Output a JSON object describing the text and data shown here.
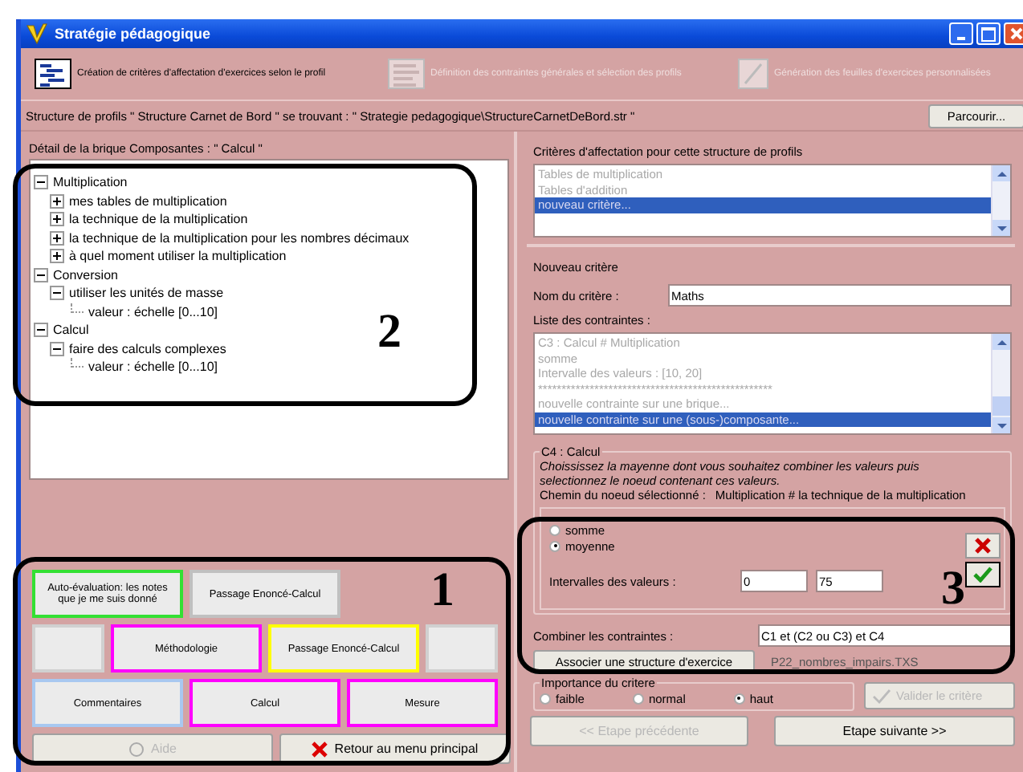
{
  "window": {
    "title": "Stratégie pédagogique"
  },
  "toolbar": [
    {
      "label": "Création de critères d'affectation d'exercices selon le profil",
      "disabled": false
    },
    {
      "label": "Définition des contraintes générales et sélection des profils",
      "disabled": true
    },
    {
      "label": "Génération des feuilles d'exercices personnalisées",
      "disabled": true
    }
  ],
  "structure_path": "Structure de profils \" Structure Carnet de Bord \" se trouvant : \" Strategie pedagogique\\StructureCarnetDeBord.str \"",
  "browse_button": "Parcourir...",
  "detail_title": "Détail de la brique Composantes : \" Calcul \"",
  "tree": [
    {
      "label": "Multiplication",
      "expanded": true,
      "children": [
        {
          "label": "mes tables de multiplication",
          "expanded": false
        },
        {
          "label": "la technique de la multiplication",
          "expanded": false
        },
        {
          "label": "la technique de la multiplication pour les nombres décimaux",
          "expanded": false
        },
        {
          "label": "à quel moment utiliser la multiplication",
          "expanded": false
        }
      ]
    },
    {
      "label": "Conversion",
      "expanded": true,
      "children": [
        {
          "label": "utiliser les unités de masse",
          "expanded": true,
          "children": [
            {
              "label": "valeur : échelle [0...10]"
            }
          ]
        }
      ]
    },
    {
      "label": "Calcul",
      "expanded": true,
      "children": [
        {
          "label": "faire des calculs complexes",
          "expanded": true,
          "children": [
            {
              "label": "valeur : échelle [0...10]"
            }
          ]
        }
      ]
    }
  ],
  "category_rows": [
    {
      "buttons": [
        {
          "kind": "wide",
          "label": "Auto-évaluation: les notes que je me suis donné",
          "color": "#33e033"
        },
        {
          "kind": "wide",
          "label": "Passage Enoncé-Calcul",
          "color": "#c0c0c0"
        }
      ]
    },
    {
      "buttons": [
        {
          "kind": "blank",
          "color": "#d0d0d0"
        },
        {
          "kind": "wide",
          "label": "Méthodologie",
          "color": "#ff00ff"
        },
        {
          "kind": "wide",
          "label": "Passage Enoncé-Calcul",
          "color": "#ffff00"
        },
        {
          "kind": "blank",
          "color": "#d0d0d0"
        }
      ]
    },
    {
      "buttons": [
        {
          "kind": "wide",
          "label": "Commentaires",
          "color": "#a8c8f0"
        },
        {
          "kind": "wide",
          "label": "Calcul",
          "color": "#ff00ff"
        },
        {
          "kind": "wide",
          "label": "Mesure",
          "color": "#ff00ff"
        }
      ]
    }
  ],
  "bottom_buttons": [
    {
      "kind": "help",
      "label": "Aide",
      "disabled": true
    },
    {
      "kind": "back",
      "label": "Retour au menu principal",
      "disabled": false
    }
  ],
  "criteria": {
    "title": "Critères d'affectation pour cette structure de profils",
    "items": [
      {
        "label": "Tables de multiplication",
        "selected": false
      },
      {
        "label": "Tables d'addition",
        "selected": false
      },
      {
        "label": "nouveau critère...",
        "selected": true
      }
    ]
  },
  "new_criterion": {
    "title": "Nouveau critère",
    "name_label": "Nom du critère :",
    "name_value": "Maths",
    "constraints_label": "Liste des contraintes :",
    "constraints": [
      {
        "label": "C3 : Calcul # Multiplication",
        "selected": false
      },
      {
        "label": "somme",
        "selected": false
      },
      {
        "label": "Intervalle des valeurs : [10, 20]",
        "selected": false
      },
      {
        "label": "**************************************************",
        "selected": false
      },
      {
        "label": "nouvelle contrainte sur une brique...",
        "selected": false
      },
      {
        "label": "nouvelle contrainte sur une (sous-)composante...",
        "selected": true
      }
    ]
  },
  "constraint_group": {
    "title": "C4 : Calcul",
    "instructions": "Choississez la mayenne dont vous souhaitez combiner les valeurs puis selectionnez le noeud contenant ces valeurs.",
    "path_label": "Chemin du noeud sélectionné :",
    "path_value": "Multiplication # la technique de la multiplication",
    "modes": [
      {
        "label": "somme",
        "selected": false
      },
      {
        "label": "moyenne",
        "selected": true
      }
    ],
    "interval_label": "Intervalles des valeurs :",
    "interval_min": "0",
    "interval_max": "75"
  },
  "combine": {
    "label": "Combiner les contraintes :",
    "value": "C1 et (C2 ou C3) et C4"
  },
  "associate": {
    "button": "Associer une structure d'exercice",
    "file": "P22_nombres_impairs.TXS"
  },
  "importance": {
    "title": "Importance du critere",
    "options": [
      {
        "label": "faible",
        "selected": false
      },
      {
        "label": "normal",
        "selected": false
      },
      {
        "label": "haut",
        "selected": true
      }
    ]
  },
  "validate_button": {
    "label": "Valider le critère",
    "disabled": true
  },
  "nav_buttons": [
    {
      "label": "<< Etape précédente",
      "disabled": true
    },
    {
      "label": "Etape suivante  >>",
      "disabled": false
    }
  ],
  "annotations": [
    {
      "label": "2"
    },
    {
      "label": "1"
    },
    {
      "label": "3"
    }
  ]
}
